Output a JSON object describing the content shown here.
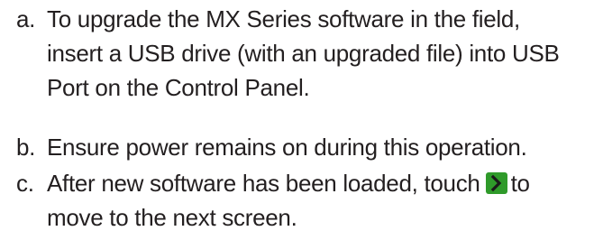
{
  "steps": [
    {
      "marker": "a.",
      "lines": [
        "To upgrade the MX Series software in the field,",
        "insert a USB drive (with an upgraded file) into USB",
        "Port on the Control Panel."
      ]
    },
    {
      "marker": "b.",
      "lines": [
        "Ensure power remains on during this operation."
      ]
    },
    {
      "marker": "c.",
      "line1_before_icon": "After new software has been loaded, touch",
      "line1_after_icon": "to",
      "icon": "next-arrow-icon",
      "icon_color": "#2f9a2a",
      "lines_after": [
        "move to the next screen."
      ]
    }
  ]
}
